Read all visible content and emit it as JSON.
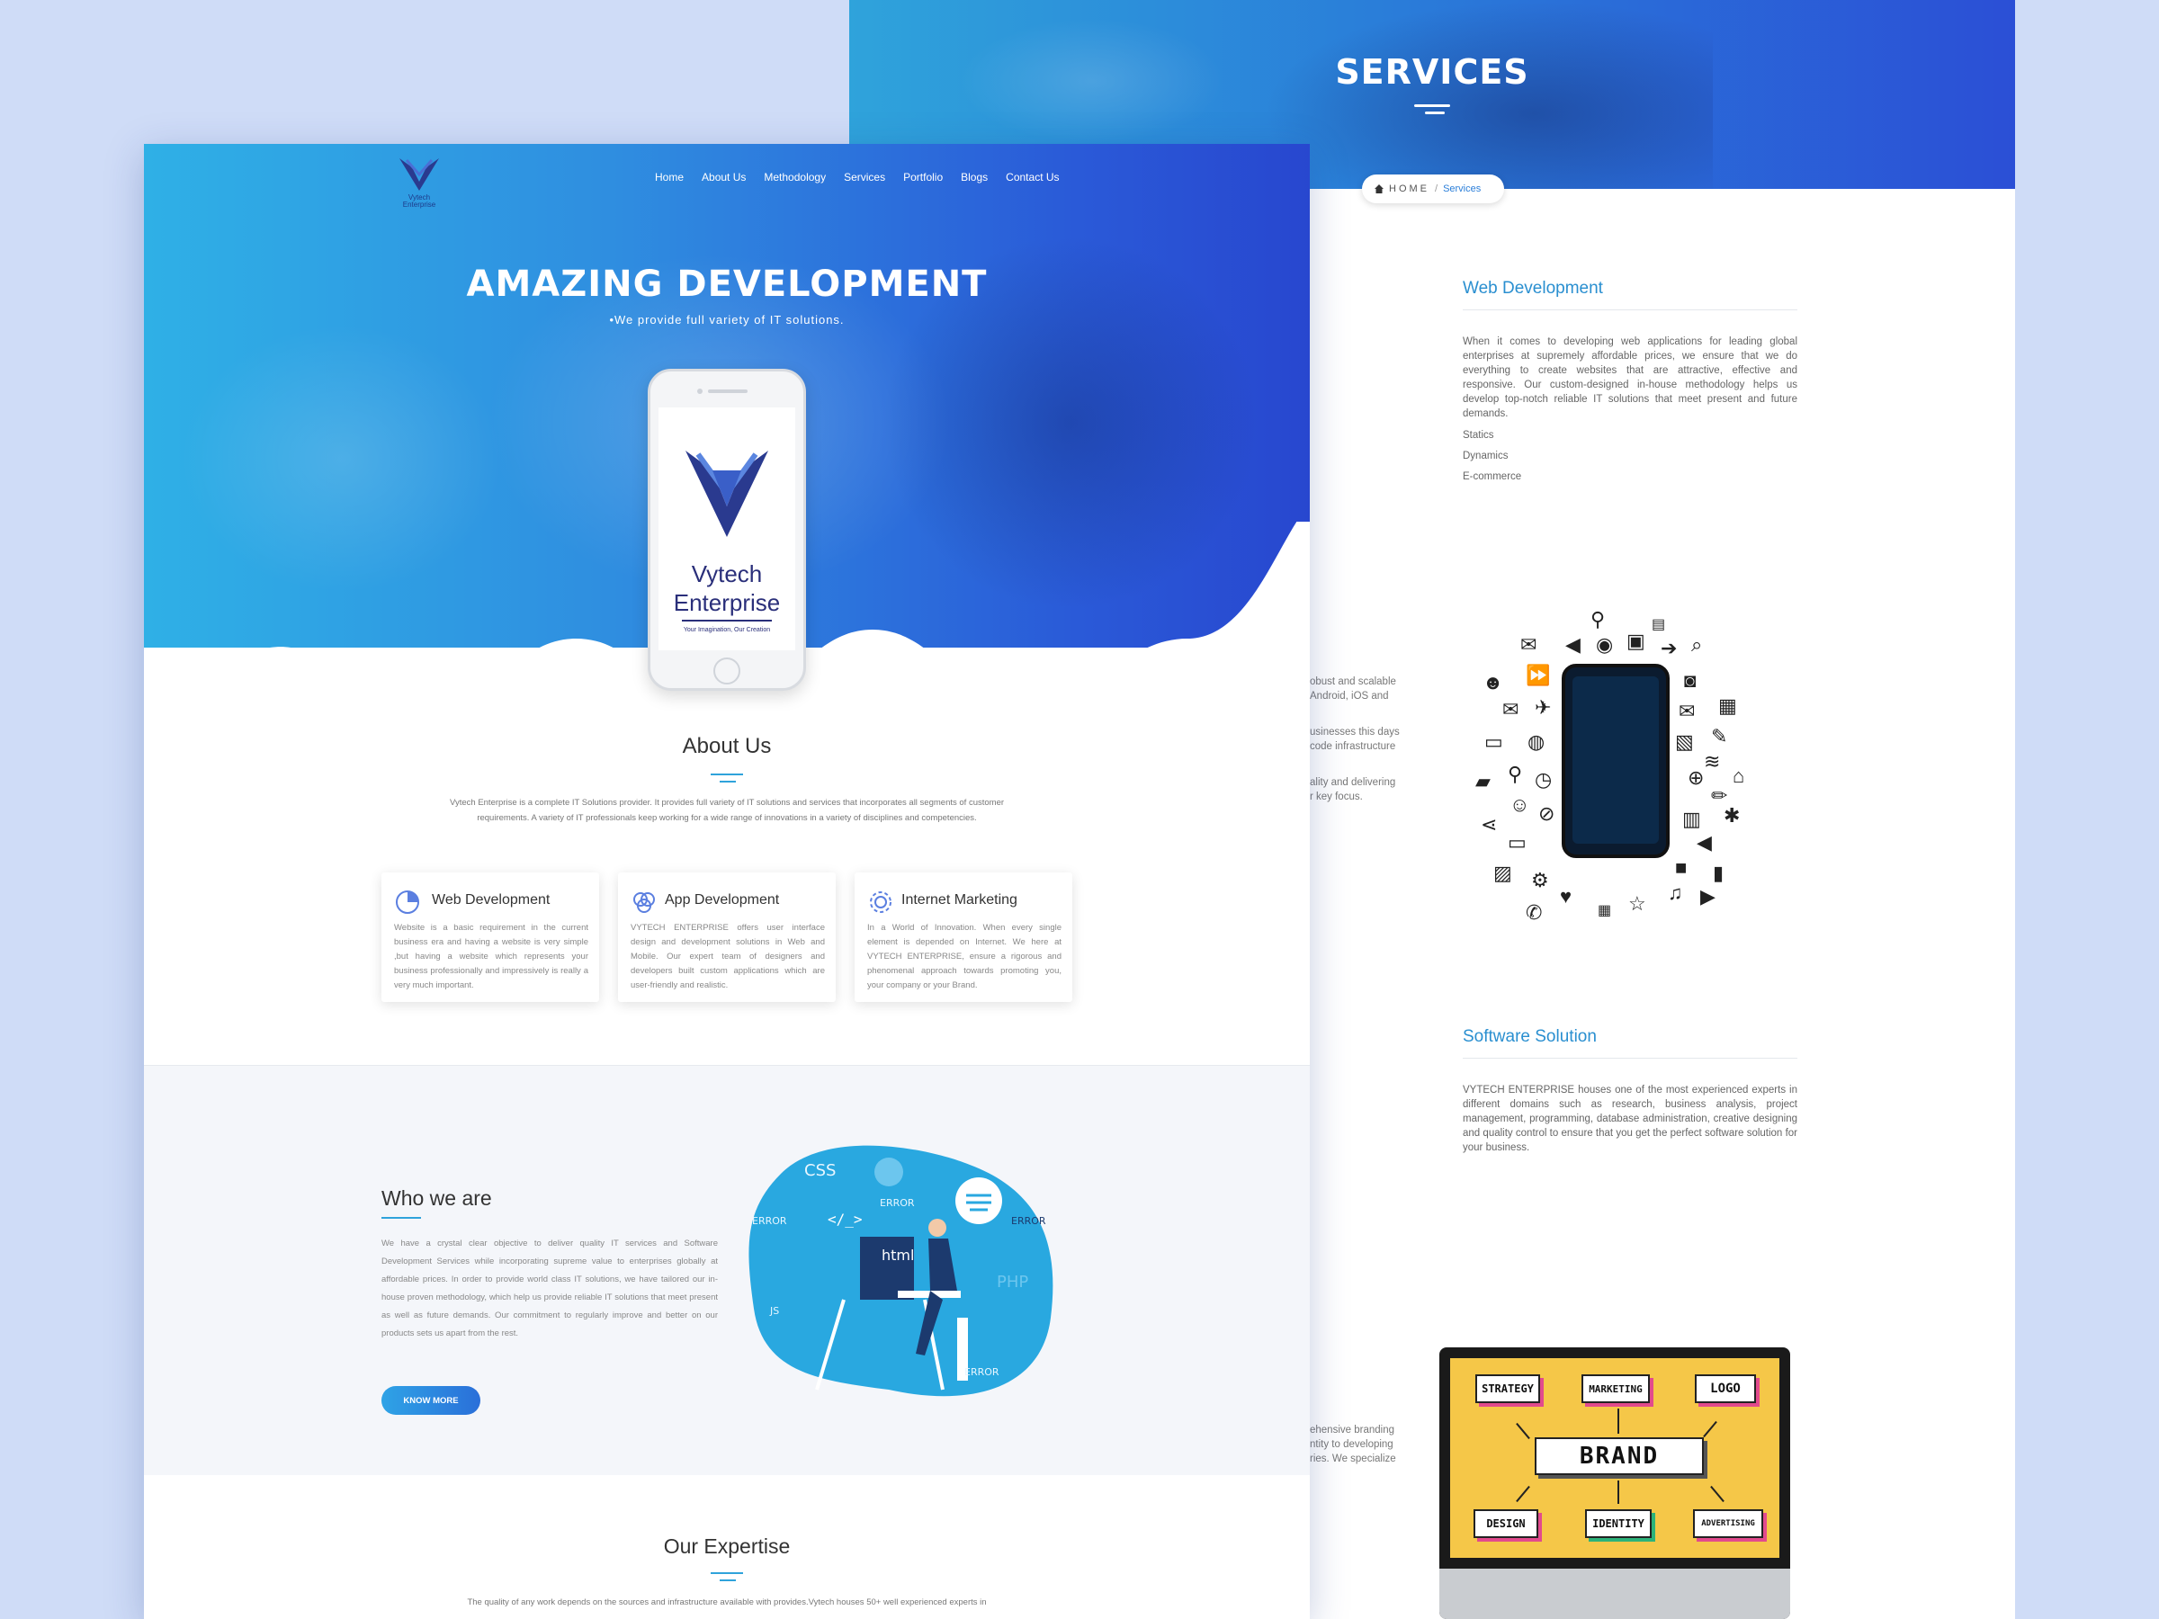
{
  "services_page": {
    "banner_title": "SERVICES",
    "breadcrumb": {
      "home": "HOME",
      "separator": "/",
      "current": "Services"
    },
    "web_development": {
      "title": "Web Development",
      "text": "When it comes to developing web applications for leading global enterprises at supremely affordable prices, we ensure that we do everything to create websites that are attractive, effective and responsive. Our custom-designed in-house methodology helps us develop top-notch reliable IT solutions that meet present and future demands.",
      "items": [
        "Statics",
        "Dynamics",
        "E-commerce"
      ]
    },
    "app_partial_lines": [
      "obust and scalable",
      "Android, iOS and",
      "usinesses this days",
      "code infrastructure",
      "ality and delivering",
      "r key focus."
    ],
    "software_solution": {
      "title": "Software Solution",
      "text": "VYTECH ENTERPRISE houses one of the most experienced experts in different domains such as research, business analysis, project management, programming, database administration, creative designing and quality control to ensure that you get the perfect software solution for your business."
    },
    "branding_partial_lines": [
      "ehensive branding",
      "ntity to developing",
      "ries. We specialize"
    ],
    "brand_board": {
      "center": "BRAND",
      "boxes": [
        "STRATEGY",
        "MARKETING",
        "LOGO",
        "DESIGN",
        "IDENTITY",
        "ADVERTISING"
      ]
    }
  },
  "home_page": {
    "logo_text": [
      "Vytech",
      "Enterprise"
    ],
    "nav": [
      "Home",
      "About Us",
      "Methodology",
      "Services",
      "Portfolio",
      "Blogs",
      "Contact Us"
    ],
    "hero": {
      "title": "AMAZING DEVELOPMENT",
      "subtitle": "•We provide full variety of IT solutions."
    },
    "phone_brand": {
      "line1": "Vytech",
      "line2": "Enterprise",
      "tagline": "Your Imagination, Our Creation"
    },
    "about": {
      "title": "About Us",
      "text": "Vytech Enterprise is a complete IT Solutions provider. It provides full variety of IT solutions and services that incorporates all segments of customer requirements. A variety of IT professionals keep working for a wide range of innovations in a variety of disciplines and competencies."
    },
    "cards": [
      {
        "title": "Web Development",
        "text": "Website is a basic requirement in the current business era and having a website is very simple ,but having a website which represents your business professionally and impressively is really a very much important."
      },
      {
        "title": "App Development",
        "text": "VYTECH ENTERPRISE offers user interface design and development solutions in Web and Mobile. Our expert team of designers and developers built custom applications which are user-friendly and realistic."
      },
      {
        "title": "Internet Marketing",
        "text": "In a World of Innovation. When every single element is depended on Internet. We here at VYTECH ENTERPRISE, ensure a rigorous and phenomenal approach towards promoting you, your company or your Brand."
      }
    ],
    "who": {
      "title": "Who we are",
      "text": "We have a crystal clear objective to deliver quality IT services and Software Development Services while incorporating supreme value to enterprises globally at affordable prices. In order to provide world class IT solutions, we have tailored our in-house proven methodology, which help us provide reliable IT solutions that meet present as well as future demands. Our commitment to regularly improve and better on our products sets us apart from the rest.",
      "button": "KNOW MORE",
      "illustration_labels": [
        "CSS",
        "ERROR",
        "</_>",
        "ERROR",
        "ERROR",
        "html",
        "JS",
        "PHP",
        "ERROR"
      ]
    },
    "expertise": {
      "title": "Our Expertise",
      "text": "The quality of any work depends on the sources and infrastructure available with provides.Vytech houses 50+ well experienced experts in"
    }
  },
  "colors": {
    "brand_blue": "#2a7ed9",
    "accent_cyan": "#2fa3db",
    "brand_dark": "#2a2f7a",
    "background": "#cfdcf7"
  }
}
